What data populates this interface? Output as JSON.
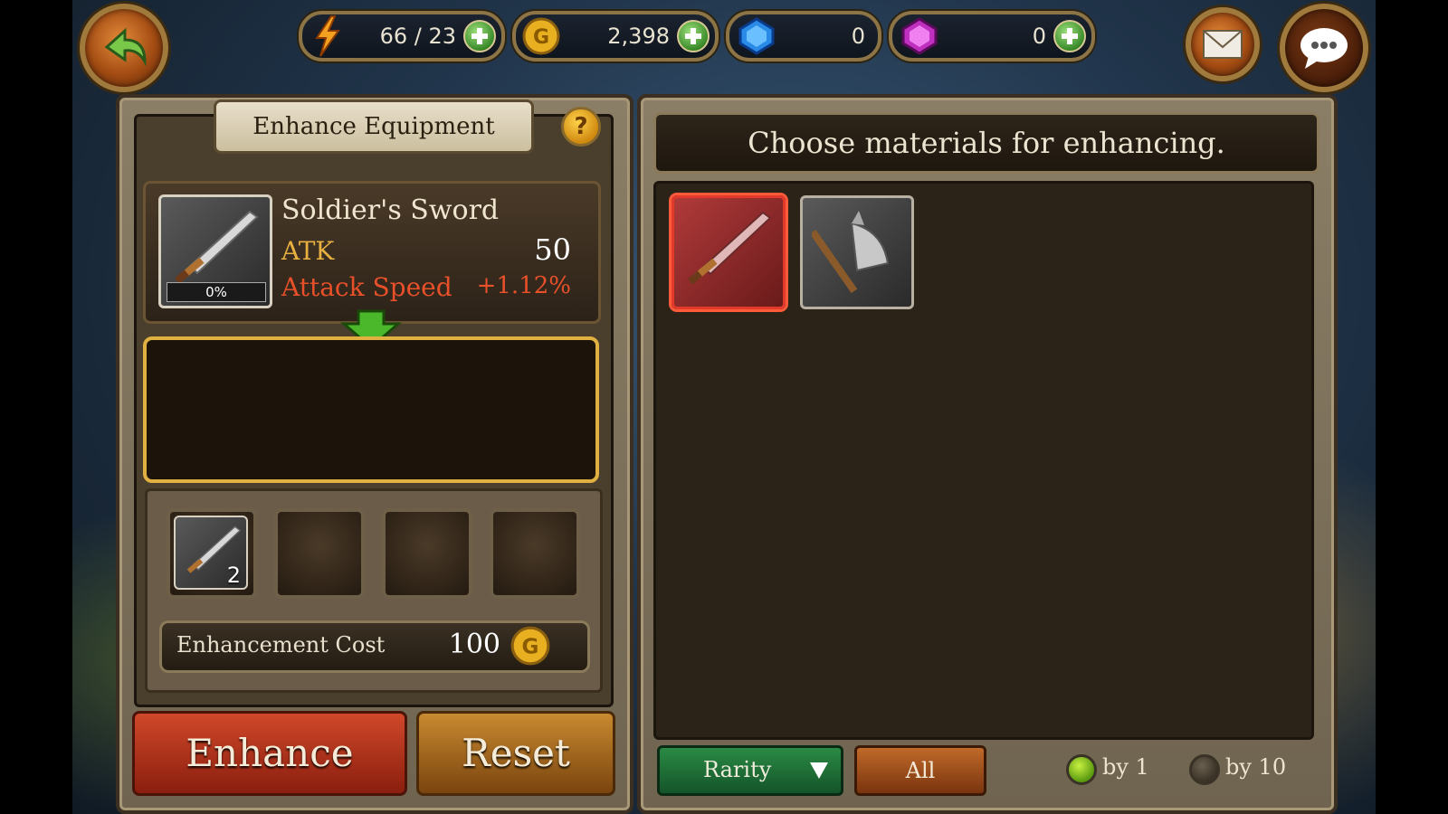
{
  "topbar": {
    "energy": "66 / 23",
    "gold": "2,398",
    "blue_gem": "0",
    "purple_gem": "0",
    "icons": [
      "back-icon",
      "lightning-icon",
      "gold-coin-icon",
      "blue-gem-icon",
      "purple-gem-icon",
      "mail-icon",
      "chat-icon"
    ]
  },
  "left_panel": {
    "title": "Enhance Equipment",
    "help": "?",
    "item": {
      "name": "Soldier's Sword",
      "stat1_label": "ATK",
      "stat1_value": "50",
      "stat2_label": "Attack Speed",
      "stat2_value": "+1.12%",
      "progress_label": "0%",
      "progress": 0
    },
    "slots": [
      {
        "count": "2",
        "filled": true
      },
      {
        "count": "",
        "filled": false
      },
      {
        "count": "",
        "filled": false
      },
      {
        "count": "",
        "filled": false
      }
    ],
    "cost_label": "Enhancement Cost",
    "cost_value": "100"
  },
  "buttons": {
    "enhance": "Enhance",
    "reset": "Reset"
  },
  "right_panel": {
    "title": "Choose materials for enhancing.",
    "materials": [
      {
        "name": "sword",
        "selected": true
      },
      {
        "name": "axe",
        "selected": false
      }
    ],
    "filter": {
      "sort": "Rarity",
      "category": "All",
      "option1": "by 1",
      "option2": "by 10",
      "selected_option": "by 1"
    }
  },
  "colors": {
    "enhance_btn": "#b0301a",
    "reset_btn": "#a0601a",
    "stat_label": "#e8b040",
    "attack_speed": "#e8502a",
    "rarity_btn": "#1e6a34"
  }
}
